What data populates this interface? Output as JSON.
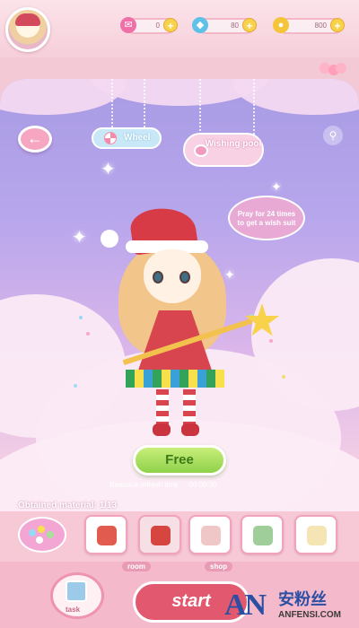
{
  "topbar": {
    "resources": [
      {
        "icon": "ticket-icon",
        "value": "0",
        "color": "#ef6fa7"
      },
      {
        "icon": "diamond-icon",
        "value": "80",
        "color": "#5fc1e8"
      },
      {
        "icon": "coin-icon",
        "value": "800",
        "color": "#f4c53a"
      }
    ],
    "plus_label": "+"
  },
  "main": {
    "back_icon": "←",
    "wheel_label": "Wheel",
    "wishing_pool_label": "Wishing pool",
    "search_icon": "⚲",
    "pray_bubble": "Pray for 24 times to get a wish suit",
    "free_label": "Free",
    "refresh_label": "Resudue refresh time",
    "refresh_time": "00:00:00",
    "obtained_label": "Obtained material: 1/13"
  },
  "materials": [
    {
      "name": "red-top",
      "color": "#e25b4f",
      "selected": false
    },
    {
      "name": "bow",
      "color": "#d6453f",
      "selected": true
    },
    {
      "name": "santa-hat",
      "color": "#f0c7c7",
      "selected": false
    },
    {
      "name": "holly",
      "color": "#9fce9a",
      "selected": false
    },
    {
      "name": "white-bow",
      "color": "#f5e5b5",
      "selected": false
    }
  ],
  "nav": {
    "task_label": "task",
    "start_label": "start",
    "room_label": "room",
    "shop_label": "shop"
  },
  "watermark": {
    "mark": "AN",
    "cn": "安粉丝",
    "en": "ANFENSI.COM"
  }
}
